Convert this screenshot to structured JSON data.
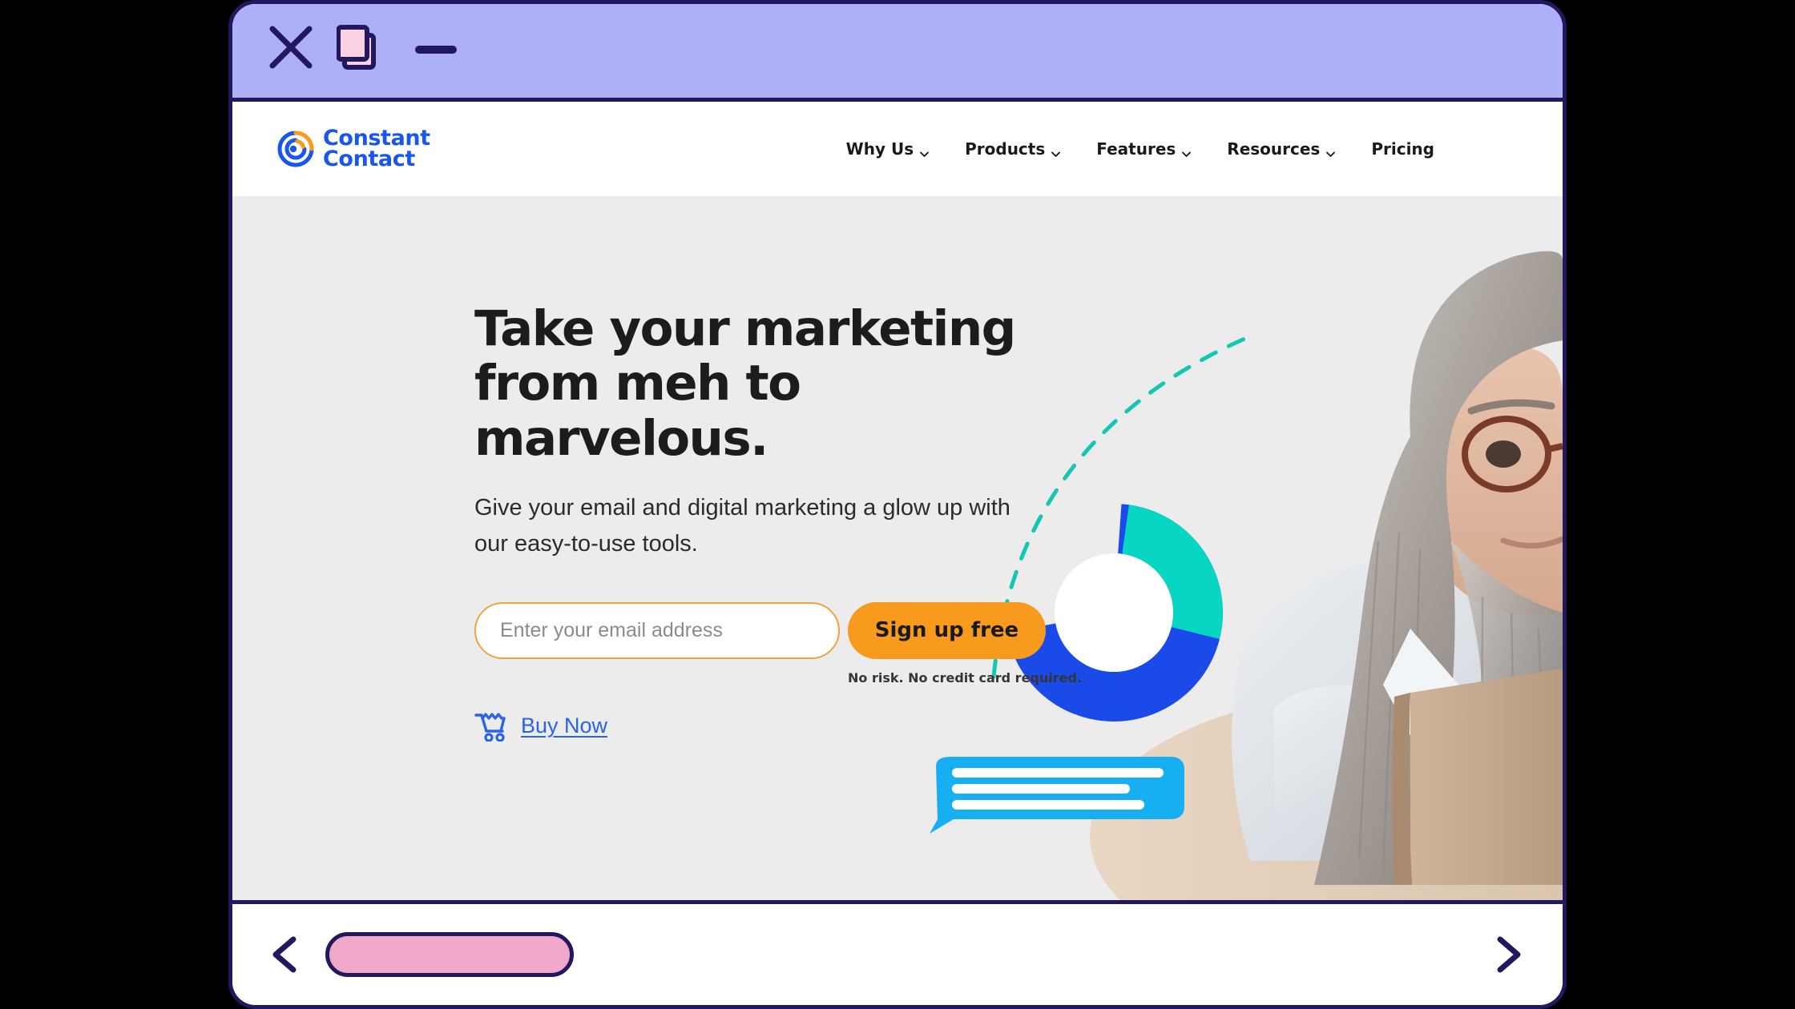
{
  "window": {
    "controls": {
      "close": "close-icon",
      "restore": "restore-icon",
      "minimize": "minimize-icon"
    },
    "titlebar_color": "#aeb0f7",
    "frame_color": "#231760"
  },
  "site": {
    "logo": {
      "name": "constant-contact-logo",
      "line1": "Constant",
      "line2": "Contact",
      "brand_blue": "#1856ed",
      "brand_orange": "#f79a1e"
    },
    "nav": [
      {
        "label": "Why Us",
        "has_chevron": true
      },
      {
        "label": "Products",
        "has_chevron": true
      },
      {
        "label": "Features",
        "has_chevron": true
      },
      {
        "label": "Resources",
        "has_chevron": true
      },
      {
        "label": "Pricing",
        "has_chevron": false
      }
    ]
  },
  "hero": {
    "headline": "Take your marketing from meh to marvelous.",
    "subheadline": "Give your email and digital marketing a glow up with our easy-to-use tools.",
    "email_placeholder": "Enter your email address",
    "email_value": "",
    "signup_button": "Sign up free",
    "fineprint": "No risk. No credit card required.",
    "buy_now": "Buy Now",
    "cart_icon": "shopping-cart-icon",
    "background_color": "#ececec",
    "art": {
      "donut_blue": "#1a4be8",
      "donut_teal": "#07d6c3",
      "bubble_blue": "#16b0f2",
      "dashed_arc": "#16c5b4"
    }
  },
  "browser_bottom_bar": {
    "back": "chevron-left-icon",
    "forward": "chevron-right-icon",
    "address_value": "",
    "address_color": "#efa7ca"
  }
}
